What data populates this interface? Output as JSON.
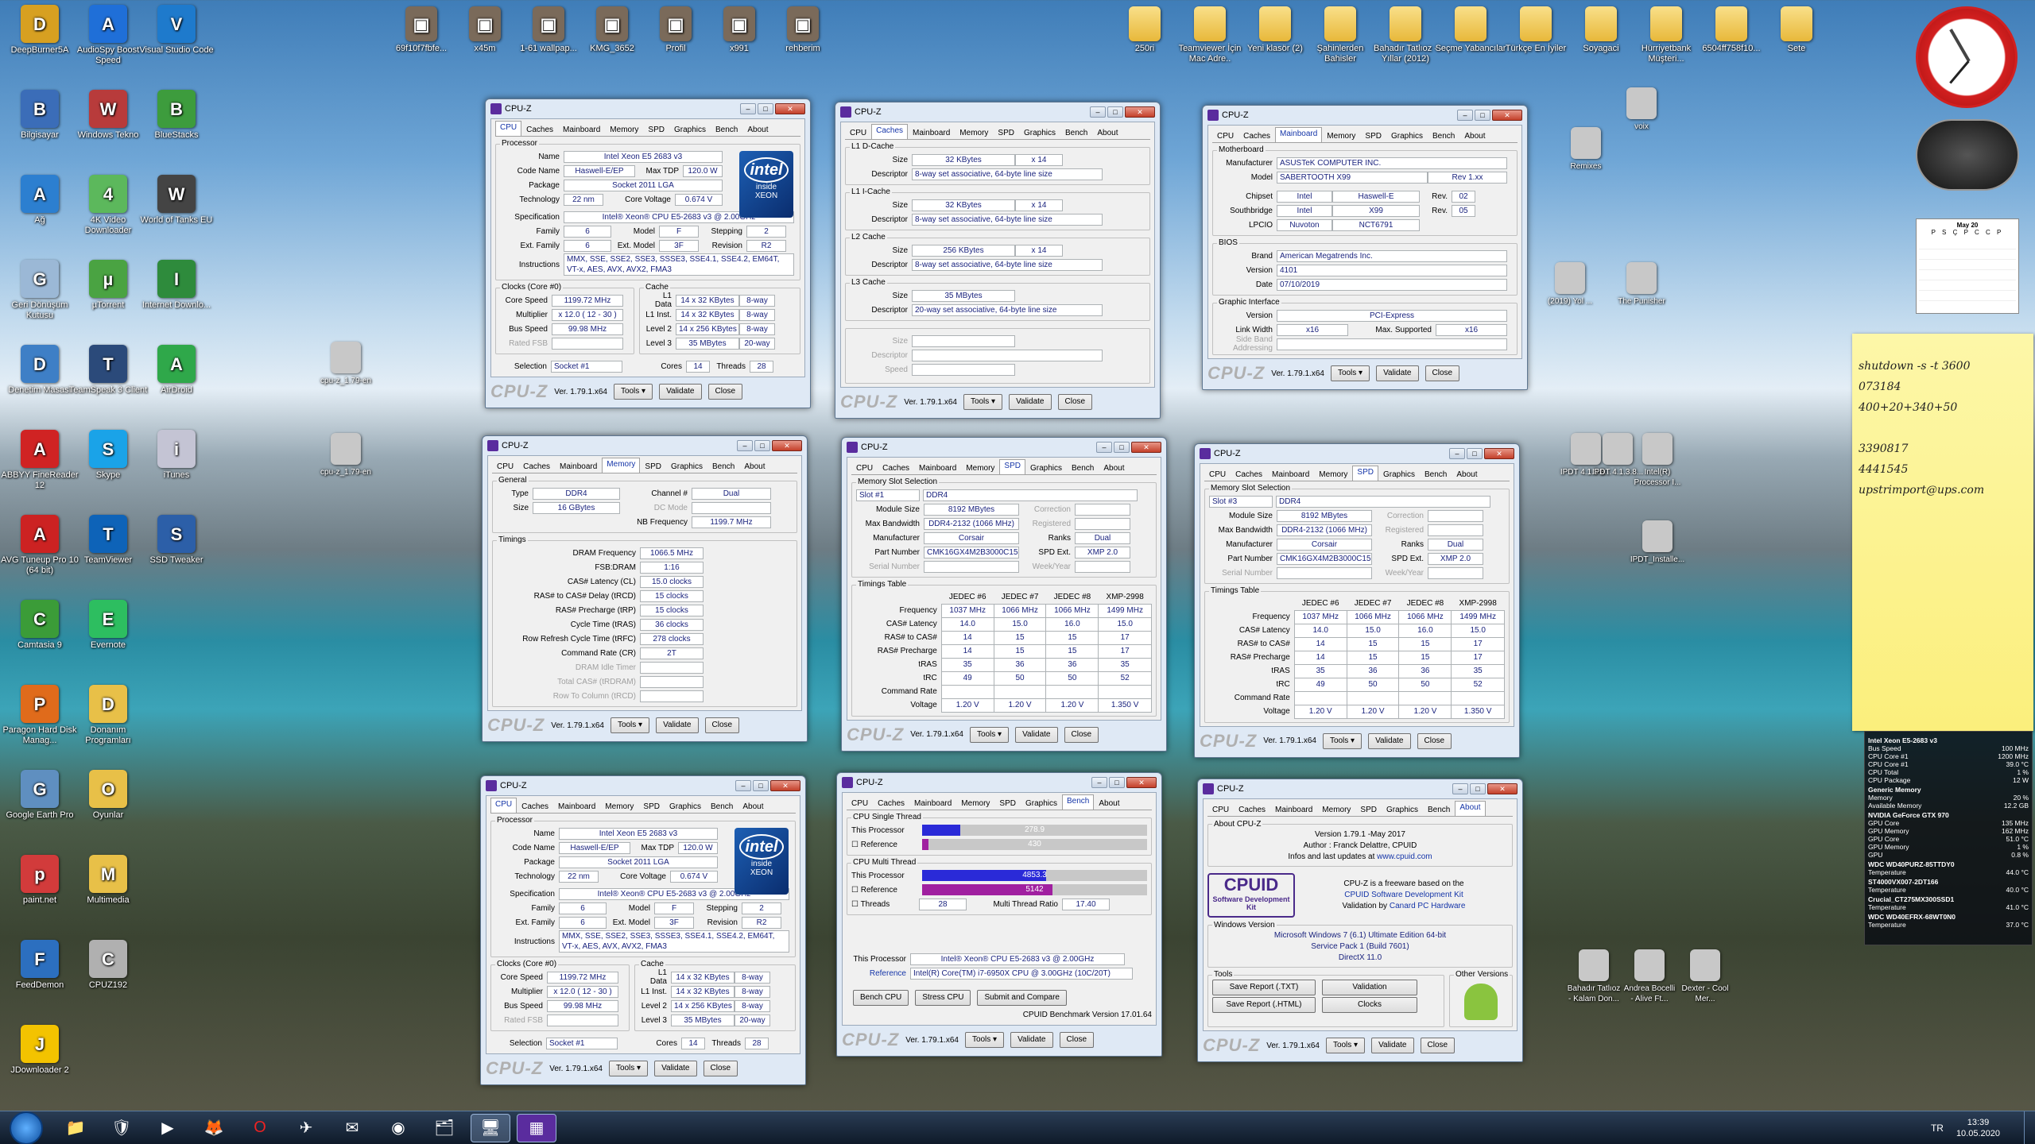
{
  "desktop_icons": [
    {
      "label": "DeepBurner5A",
      "k": "g",
      "c": "#d7a021"
    },
    {
      "label": "AudioSpy Boost Speed",
      "k": "g",
      "c": "#1f6fd8"
    },
    {
      "label": "Visual Studio Code",
      "k": "g",
      "c": "#1e7acc"
    },
    {
      "label": "Bilgisayar",
      "k": "g",
      "c": "#3b6db8"
    },
    {
      "label": "Windows Tekno",
      "k": "g",
      "c": "#b83b3b"
    },
    {
      "label": "BlueStacks",
      "k": "g",
      "c": "#3d9c3d"
    },
    {
      "label": "Ağ",
      "k": "g",
      "c": "#2c7fd0"
    },
    {
      "label": "4K Video Downloader",
      "k": "g",
      "c": "#5cb85c"
    },
    {
      "label": "World of Tanks EU",
      "k": "g",
      "c": "#444"
    },
    {
      "label": "Geri Dönüşüm Kutusu",
      "k": "g",
      "c": "#9bb8d6"
    },
    {
      "label": "µTorrent",
      "k": "g",
      "c": "#4aa342"
    },
    {
      "label": "Internet Downlo...",
      "k": "g",
      "c": "#2e8b3c"
    },
    {
      "label": "Denetim Masası",
      "k": "g",
      "c": "#3e7fc6"
    },
    {
      "label": "TeamSpeak 3 Client",
      "k": "g",
      "c": "#2b4a7a"
    },
    {
      "label": "AirDroid",
      "k": "g",
      "c": "#2fa84a"
    },
    {
      "label": "ABBYY FineReader 12",
      "k": "g",
      "c": "#d02323"
    },
    {
      "label": "Skype",
      "k": "g",
      "c": "#1aa3e8"
    },
    {
      "label": "iTunes",
      "k": "g",
      "c": "#c4c4d4"
    },
    {
      "label": "AVG Tuneup Pro 10 (64 bit)",
      "k": "g",
      "c": "#c22"
    },
    {
      "label": "TeamViewer",
      "k": "g",
      "c": "#0e63b8"
    },
    {
      "label": "SSD Tweaker",
      "k": "g",
      "c": "#2c5fa8"
    },
    {
      "label": "Camtasia 9",
      "k": "g",
      "c": "#3b9c38"
    },
    {
      "label": "Evernote",
      "k": "g",
      "c": "#2dbe60"
    },
    {
      "label": "Paragon Hard Disk Manag...",
      "k": "g",
      "c": "#e06b1b"
    },
    {
      "label": "Donanım Programları",
      "k": "g",
      "c": "#e8c048"
    },
    {
      "label": "Google Earth Pro",
      "k": "g",
      "c": "#5f8fc0"
    },
    {
      "label": "Oyunlar",
      "k": "g",
      "c": "#e8c048"
    },
    {
      "label": "paint.net",
      "k": "g",
      "c": "#d23b3b"
    },
    {
      "label": "Multimedia",
      "k": "g",
      "c": "#e8c048"
    },
    {
      "label": "FeedDemon",
      "k": "g",
      "c": "#2c6fbf"
    },
    {
      "label": "CPUZ192",
      "k": "g",
      "c": "#b0b0b0"
    },
    {
      "label": "JDownloader 2",
      "k": "g",
      "c": "#f3c300"
    }
  ],
  "top_icons": [
    "69f10f7fbfe...",
    "x45m",
    "1-61 wallpap...",
    "KMG_3652",
    "Profil",
    "x991",
    "rehberim"
  ],
  "top_right_icons": [
    "250ri",
    "Teamviewer İçin Mac Adre..",
    "Yeni klasör (2)",
    "Şahinlerden Bahisler",
    "Bahadır Tatlıoz - Yıllar (2012)",
    "Seçme Yabancılar",
    "Türkçe En İyiler",
    "Soyagaci",
    "Hürriyetbank Müşteri...",
    "6504ff758f10...",
    "Sete"
  ],
  "mid_icons": [
    "cpu-z_1.79-en",
    "cpu-z_1.79-en",
    "Remixes",
    "voix",
    "The Punisher",
    "(2019) Yol ...",
    "IPDT 4.1.3.8...",
    "IPDT 4.1.3.8...",
    "Intel(R) Processor I...",
    "IPDT_Installe...",
    "Bahadır Tatlıoz - Kalam Don...",
    "Andrea Bocelli - Alive Ft...",
    "Dexter - Cool Mer..."
  ],
  "cpu1": {
    "title": "CPU-Z",
    "tabs": [
      "CPU",
      "Caches",
      "Mainboard",
      "Memory",
      "SPD",
      "Graphics",
      "Bench",
      "About"
    ],
    "name": "Intel Xeon E5 2683 v3",
    "codename": "Haswell-E/EP",
    "maxtdp": "120.0 W",
    "package": "Socket 2011 LGA",
    "technology": "22 nm",
    "corevoltage": "0.674 V",
    "spec": "Intel® Xeon® CPU E5-2683 v3 @ 2.00GHz",
    "family": "6",
    "model": "F",
    "stepping": "2",
    "extfamily": "6",
    "extmodel": "3F",
    "revision": "R2",
    "instructions": "MMX, SSE, SSE2, SSE3, SSSE3, SSE4.1, SSE4.2, EM64T, VT-x, AES, AVX, AVX2, FMA3",
    "corespeed": "1199.72 MHz",
    "multiplier": "x 12.0 ( 12 - 30 )",
    "busspeed": "99.98 MHz",
    "ratedfsb": "Rated FSB",
    "l1d": "14 x 32 KBytes",
    "l1dw": "8-way",
    "l1i": "14 x 32 KBytes",
    "l1iw": "8-way",
    "l2": "14 x 256 KBytes",
    "l2w": "8-way",
    "l3": "35 MBytes",
    "l3w": "20-way",
    "selection": "Socket #1",
    "cores": "14",
    "threads": "28",
    "version": "Ver. 1.79.1.x64"
  },
  "caches": {
    "l1d_size": "32 KBytes",
    "l1d_x": "x 14",
    "l1d_desc": "8-way set associative, 64-byte line size",
    "l1i_size": "32 KBytes",
    "l1i_x": "x 14",
    "l1i_desc": "8-way set associative, 64-byte line size",
    "l2_size": "256 KBytes",
    "l2_x": "x 14",
    "l2_desc": "8-way set associative, 64-byte line size",
    "l3_size": "35 MBytes",
    "l3_desc": "20-way set associative, 64-byte line size"
  },
  "mainboard": {
    "manufacturer": "ASUSTeK COMPUTER INC.",
    "model": "SABERTOOTH X99",
    "rev": "Rev 1.xx",
    "chipset_v": "Intel",
    "chipset_n": "Haswell-E",
    "chipset_r": "02",
    "south_v": "Intel",
    "south_n": "X99",
    "south_r": "05",
    "lpcio_v": "Nuvoton",
    "lpcio_n": "NCT6791",
    "bios_brand": "American Megatrends Inc.",
    "bios_version": "4101",
    "bios_date": "07/10/2019",
    "gi_version": "PCI-Express",
    "gi_width": "x16",
    "gi_max": "x16"
  },
  "memory": {
    "type": "DDR4",
    "channel": "Dual",
    "size": "16 GBytes",
    "dcmode": "DC Mode",
    "nbfreq": "1199.7 MHz",
    "dram": "1066.5 MHz",
    "fsbdram": "1:16",
    "cl": "15.0 clocks",
    "trcd": "15 clocks",
    "trp": "15 clocks",
    "tras": "36 clocks",
    "trfc": "278 clocks",
    "cr": "2T"
  },
  "spd1": {
    "slot": "Slot #1",
    "ddr": "DDR4",
    "modsize": "8192 MBytes",
    "maxbw": "DDR4-2132 (1066 MHz)",
    "mfr": "Corsair",
    "ranks": "Dual",
    "part": "CMK16GX4M2B3000C15",
    "spdext": "XMP 2.0"
  },
  "spd3": {
    "slot": "Slot #3",
    "ddr": "DDR4",
    "modsize": "8192 MBytes",
    "maxbw": "DDR4-2132 (1066 MHz)",
    "mfr": "Corsair",
    "ranks": "Dual",
    "part": "CMK16GX4M2B3000C15",
    "spdext": "XMP 2.0"
  },
  "timings": {
    "heads": [
      "JEDEC #6",
      "JEDEC #7",
      "JEDEC #8",
      "XMP-2998"
    ],
    "rows": [
      [
        "Frequency",
        "1037 MHz",
        "1066 MHz",
        "1066 MHz",
        "1499 MHz"
      ],
      [
        "CAS# Latency",
        "14.0",
        "15.0",
        "16.0",
        "15.0"
      ],
      [
        "RAS# to CAS#",
        "14",
        "15",
        "15",
        "17"
      ],
      [
        "RAS# Precharge",
        "14",
        "15",
        "15",
        "17"
      ],
      [
        "tRAS",
        "35",
        "36",
        "36",
        "35"
      ],
      [
        "tRC",
        "49",
        "50",
        "50",
        "52"
      ],
      [
        "Command Rate",
        "",
        "",
        "",
        ""
      ],
      [
        "Voltage",
        "1.20 V",
        "1.20 V",
        "1.20 V",
        "1.350 V"
      ]
    ]
  },
  "bench": {
    "this_single": "278.9",
    "ref_single": "430",
    "this_multi": "4853.3",
    "ref_multi": "5142",
    "threads": "28",
    "ratio": "17.40",
    "processor": "Intel® Xeon® CPU E5-2683 v3 @ 2.00GHz",
    "reference": "Intel(R) Core(TM) i7-6950X CPU @ 3.00GHz (10C/20T)",
    "version": "CPUID Benchmark Version 17.01.64"
  },
  "about": {
    "version": "Version 1.79.1  -May 2017",
    "author": "Author : Franck Delattre, CPUID",
    "info": "Infos and last updates at",
    "url": "www.cpuid.com",
    "free": "CPU-Z is a freeware based on the",
    "sdk": "CPUID Software Development Kit",
    "validation": "Validation by",
    "canard": "Canard PC Hardware",
    "os": "Microsoft Windows 7 (6.1) Ultimate Edition 64-bit",
    "sp": "Service Pack 1 (Build 7601)",
    "dx": "DirectX 11.0"
  },
  "sticky": [
    "shutdown -s -t 3600",
    "073184",
    "400+20+340+50",
    "",
    "3390817",
    "4441545",
    "upstrimport@ups.com"
  ],
  "gadget": [
    [
      "Intel Xeon E5-2683 v3",
      ""
    ],
    [
      "Bus Speed",
      "100 MHz"
    ],
    [
      "CPU Core #1",
      "1200 MHz"
    ],
    [
      "CPU Core #1",
      "39.0 °C"
    ],
    [
      "CPU Total",
      "1 %"
    ],
    [
      "CPU Package",
      "12 W"
    ],
    [
      "Generic Memory",
      ""
    ],
    [
      "Memory",
      "20 %"
    ],
    [
      "Available Memory",
      "12.2 GB"
    ],
    [
      "NVIDIA GeForce GTX 970",
      ""
    ],
    [
      "GPU Core",
      "135 MHz"
    ],
    [
      "GPU Memory",
      "162 MHz"
    ],
    [
      "GPU Core",
      "51.0 °C"
    ],
    [
      "GPU Memory",
      "1 %"
    ],
    [
      "GPU",
      "0.8 %"
    ],
    [
      "WDC WD40PURZ-85TTDY0",
      ""
    ],
    [
      "Temperature",
      "44.0 °C"
    ],
    [
      "ST4000VX007-2DT166",
      ""
    ],
    [
      "Temperature",
      "40.0 °C"
    ],
    [
      "Crucial_CT275MX300SSD1",
      ""
    ],
    [
      "Temperature",
      "41.0 °C"
    ],
    [
      "WDC WD40EFRX-68WT0N0",
      ""
    ],
    [
      "Temperature",
      "37.0 °C"
    ]
  ],
  "calendar": {
    "month": "May 20",
    "days": "P S Ç P C C P"
  },
  "tray": {
    "lang": "TR",
    "time": "13:39",
    "date": "10.05.2020"
  }
}
